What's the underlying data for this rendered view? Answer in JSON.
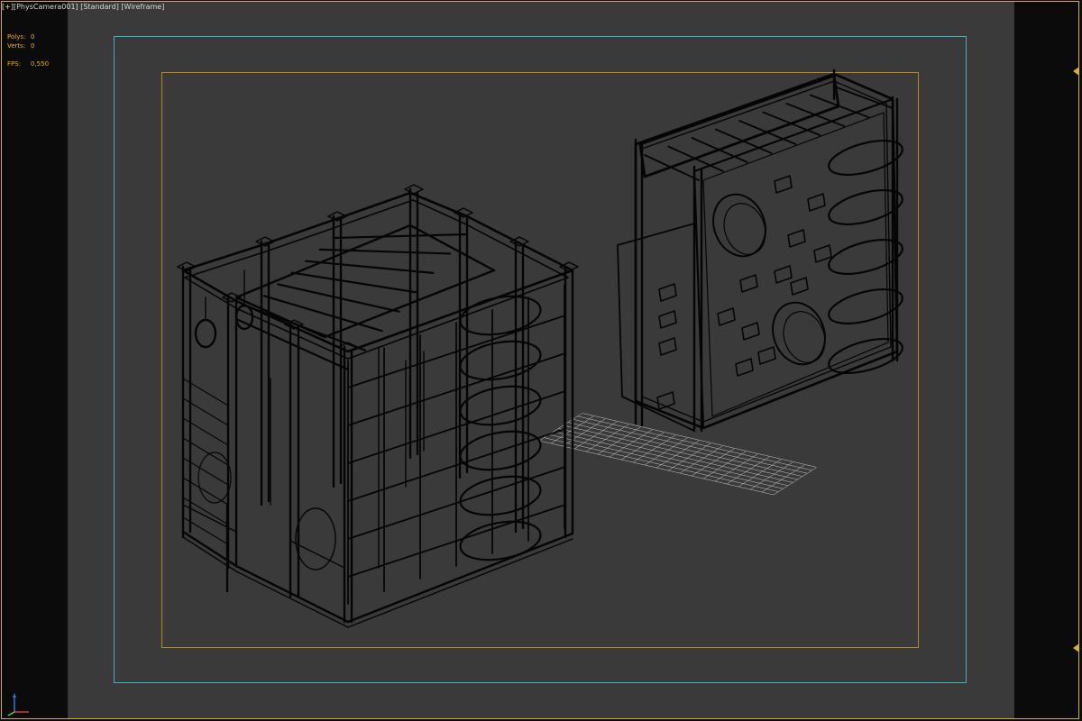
{
  "viewport_label": {
    "plus": "[+]",
    "camera": "[PhysCamera001]",
    "shading": "[Standard]",
    "mode": "[Wireframe]"
  },
  "stats": {
    "polys_label": "Polys:",
    "polys_value": "0",
    "verts_label": "Verts:",
    "verts_value": "0",
    "fps_label": "FPS:",
    "fps_value": "0,550"
  },
  "colors": {
    "background": "#3a3a3a",
    "viewport_border": "#d2b031",
    "safe_frame_outer": "#3fb1c4",
    "safe_frame_inner": "#b8891e",
    "wire": "#000000",
    "grid": "#c8c8c8"
  },
  "icons": [
    "axis-tripod-icon",
    "scroll-up-triangle-icon",
    "scroll-down-triangle-icon"
  ]
}
